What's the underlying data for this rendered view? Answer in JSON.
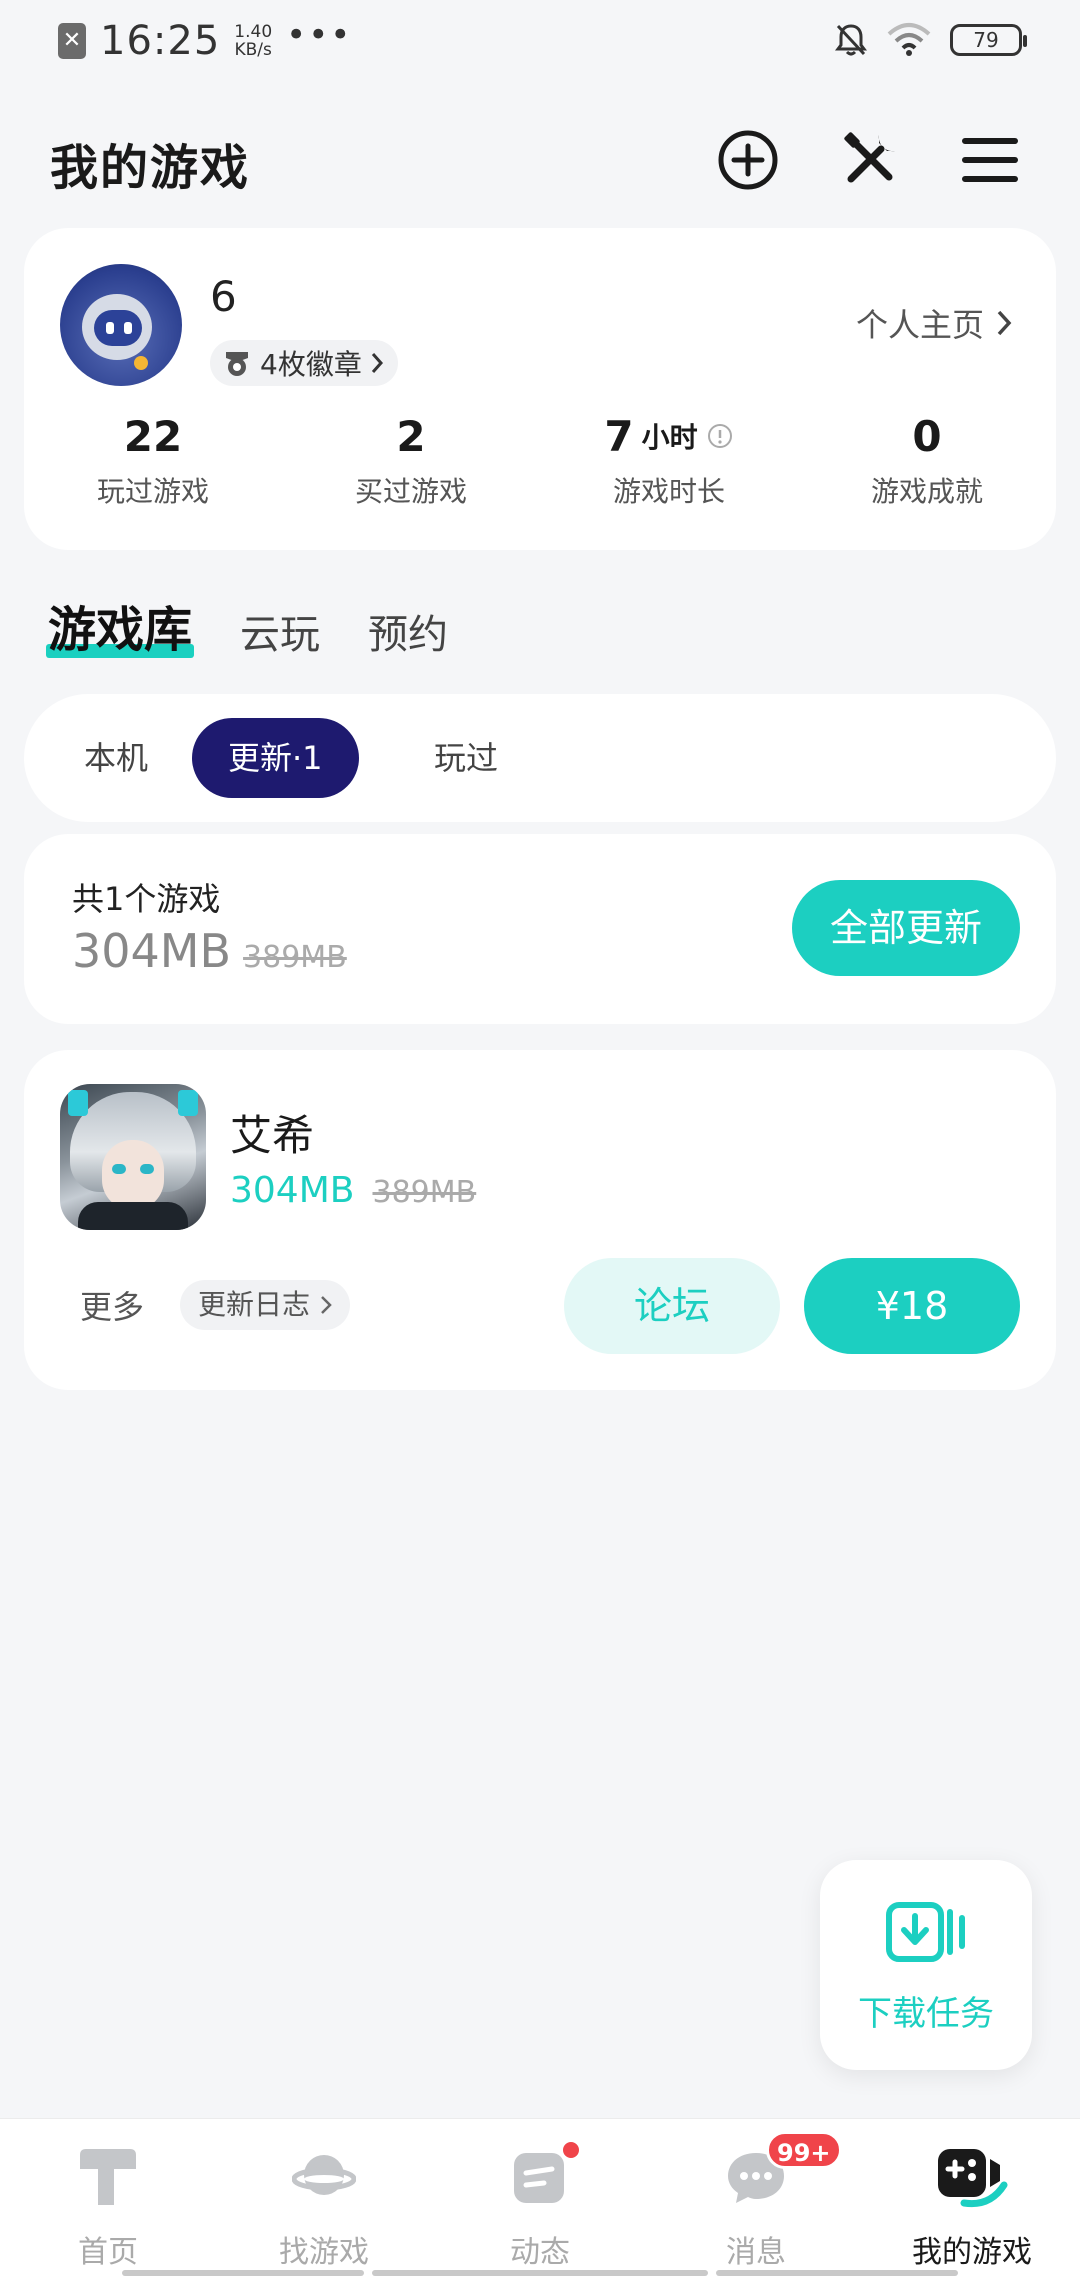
{
  "status_bar": {
    "time": "16:25",
    "speed_value": "1.40",
    "speed_unit": "KB/s",
    "more": "•••",
    "battery": "79"
  },
  "header": {
    "title": "我的游戏"
  },
  "profile": {
    "username": "6",
    "badge_text": "4枚徽章",
    "homepage_link": "个人主页",
    "stats": [
      {
        "value": "22",
        "unit": "",
        "label": "玩过游戏"
      },
      {
        "value": "2",
        "unit": "",
        "label": "买过游戏"
      },
      {
        "value": "7",
        "unit": "小时",
        "label": "游戏时长"
      },
      {
        "value": "0",
        "unit": "",
        "label": "游戏成就"
      }
    ]
  },
  "tabs": [
    {
      "label": "游戏库"
    },
    {
      "label": "云玩"
    },
    {
      "label": "预约"
    }
  ],
  "filters": [
    {
      "label": "本机"
    },
    {
      "label": "更新·1"
    },
    {
      "label": "玩过"
    }
  ],
  "summary": {
    "title": "共1个游戏",
    "new_size": "304MB",
    "old_size": "389MB",
    "update_all_label": "全部更新"
  },
  "game": {
    "name": "艾希",
    "new_size": "304MB",
    "old_size": "389MB",
    "more_label": "更多",
    "changelog_label": "更新日志",
    "forum_label": "论坛",
    "price_label": "¥18"
  },
  "download_fab": {
    "label": "下载任务"
  },
  "bottom_nav": {
    "items": [
      {
        "label": "首页"
      },
      {
        "label": "找游戏"
      },
      {
        "label": "动态"
      },
      {
        "label": "消息",
        "badge": "99+"
      },
      {
        "label": "我的游戏"
      }
    ]
  },
  "colors": {
    "accent": "#1ccfc1",
    "active_pill": "#1e1a6f",
    "badge_red": "#f0444a",
    "background": "#f5f6f8"
  }
}
